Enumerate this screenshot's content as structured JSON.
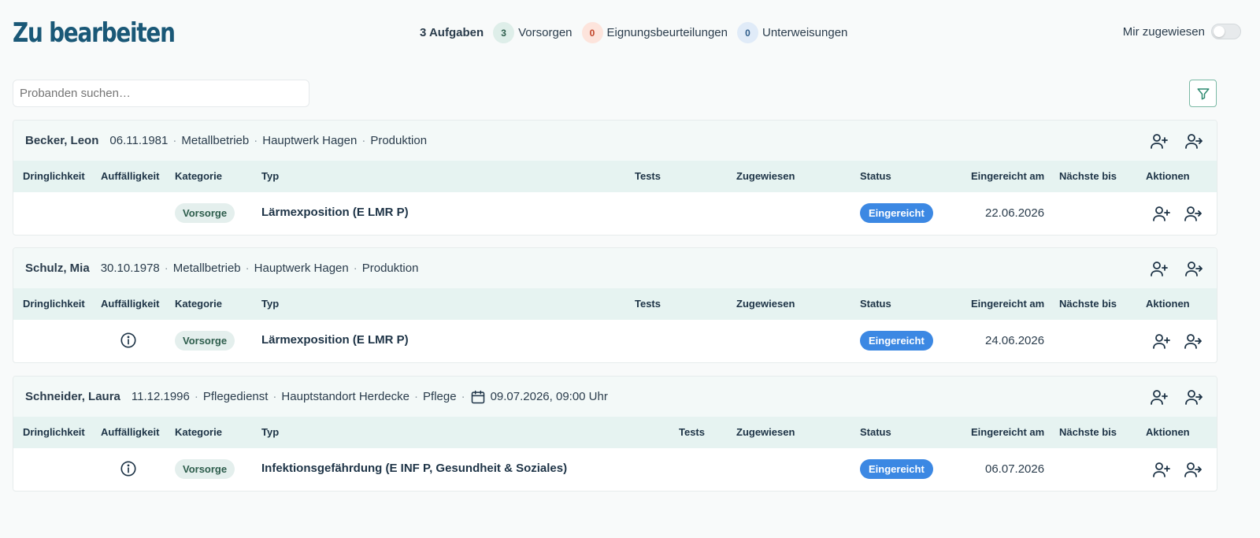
{
  "header": {
    "title": "Zu bearbeiten",
    "total_tasks": "3 Aufgaben",
    "counts": [
      {
        "value": "3",
        "label": "Vorsorgen",
        "color": "#deeee9"
      },
      {
        "value": "0",
        "label": "Eignungsbeurteilungen",
        "color": "#fde4dc"
      },
      {
        "value": "0",
        "label": "Unterweisungen",
        "color": "#e0ebf8"
      }
    ],
    "assigned_toggle_label": "Mir zugewiesen",
    "assigned_toggle_on": false
  },
  "search": {
    "placeholder": "Probanden suchen…"
  },
  "filter_icon": "filter-icon",
  "columns": {
    "dringlichkeit": "Dringlichkeit",
    "auffaelligkeit": "Auffälligkeit",
    "kategorie": "Kategorie",
    "typ": "Typ",
    "tests": "Tests",
    "zugewiesen": "Zugewiesen",
    "status": "Status",
    "eingereicht": "Eingereicht am",
    "naechste": "Nächste bis",
    "aktionen": "Aktionen"
  },
  "cards": [
    {
      "name": "Becker, Leon",
      "birthdate": "06.11.1981",
      "company": "Metallbetrieb",
      "site": "Hauptwerk Hagen",
      "department": "Produktion",
      "appointment": "",
      "rows": [
        {
          "info": false,
          "category": "Vorsorge",
          "type": "Lärmexposition (E LMR P)",
          "status": "Eingereicht",
          "submitted": "22.06.2026"
        }
      ]
    },
    {
      "name": "Schulz, Mia",
      "birthdate": "30.10.1978",
      "company": "Metallbetrieb",
      "site": "Hauptwerk Hagen",
      "department": "Produktion",
      "appointment": "",
      "rows": [
        {
          "info": true,
          "category": "Vorsorge",
          "type": "Lärmexposition (E LMR P)",
          "status": "Eingereicht",
          "submitted": "24.06.2026"
        }
      ]
    },
    {
      "name": "Schneider, Laura",
      "birthdate": "11.12.1996",
      "company": "Pflegedienst",
      "site": "Hauptstandort Herdecke",
      "department": "Pflege",
      "appointment": "09.07.2026, 09:00 Uhr",
      "rows": [
        {
          "info": true,
          "category": "Vorsorge",
          "type": "Infektionsgefährdung (E INF P, Gesundheit & Soziales)",
          "status": "Eingereicht",
          "submitted": "06.07.2026"
        }
      ]
    }
  ],
  "colors": {
    "title": "#1a5877",
    "status": "#3c88e3",
    "category_pill": "#e4efed",
    "card_header": "#f3f9f8",
    "table_header": "#e6f3f1"
  }
}
